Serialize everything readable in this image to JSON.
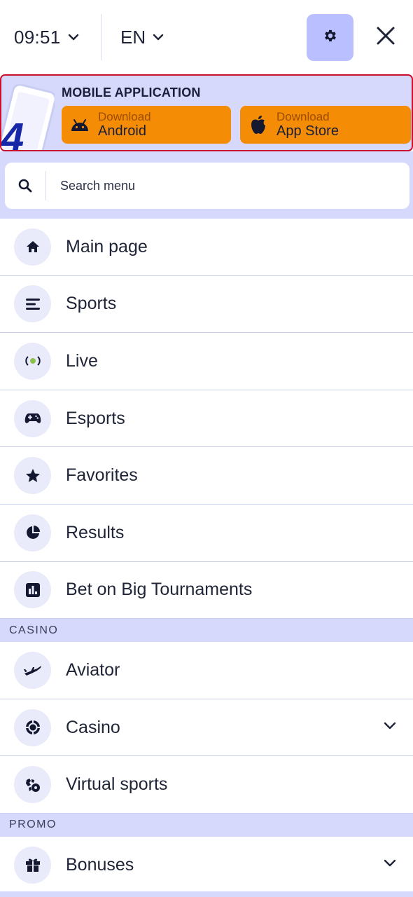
{
  "header": {
    "time": "09:51",
    "language": "EN"
  },
  "app_banner": {
    "title": "MOBILE APPLICATION",
    "logo_text": "4",
    "android": {
      "small": "Download",
      "big": "Android"
    },
    "ios": {
      "small": "Download",
      "big": "App Store"
    }
  },
  "search": {
    "placeholder": "Search menu"
  },
  "menu": {
    "main": [
      {
        "label": "Main page",
        "icon": "home-icon"
      },
      {
        "label": "Sports",
        "icon": "sports-list-icon"
      },
      {
        "label": "Live",
        "icon": "live-broadcast-icon"
      },
      {
        "label": "Esports",
        "icon": "gamepad-icon"
      },
      {
        "label": "Favorites",
        "icon": "star-icon"
      },
      {
        "label": "Results",
        "icon": "pie-chart-icon"
      },
      {
        "label": "Bet on Big Tournaments",
        "icon": "bar-chart-icon"
      }
    ],
    "casino_header": "CASINO",
    "casino": [
      {
        "label": "Aviator",
        "icon": "airplane-icon"
      },
      {
        "label": "Casino",
        "icon": "casino-chip-icon",
        "expandable": true
      },
      {
        "label": "Virtual sports",
        "icon": "virtual-sports-icon"
      }
    ],
    "promo_header": "PROMO",
    "promo": [
      {
        "label": "Bonuses",
        "icon": "gift-icon",
        "expandable": true
      }
    ]
  },
  "colors": {
    "accent": "#f48c06",
    "banner_bg": "#d6d9fb",
    "settings_bg": "#b9bfff",
    "live_dot": "#8bc34a",
    "banner_border": "#c8102e"
  }
}
